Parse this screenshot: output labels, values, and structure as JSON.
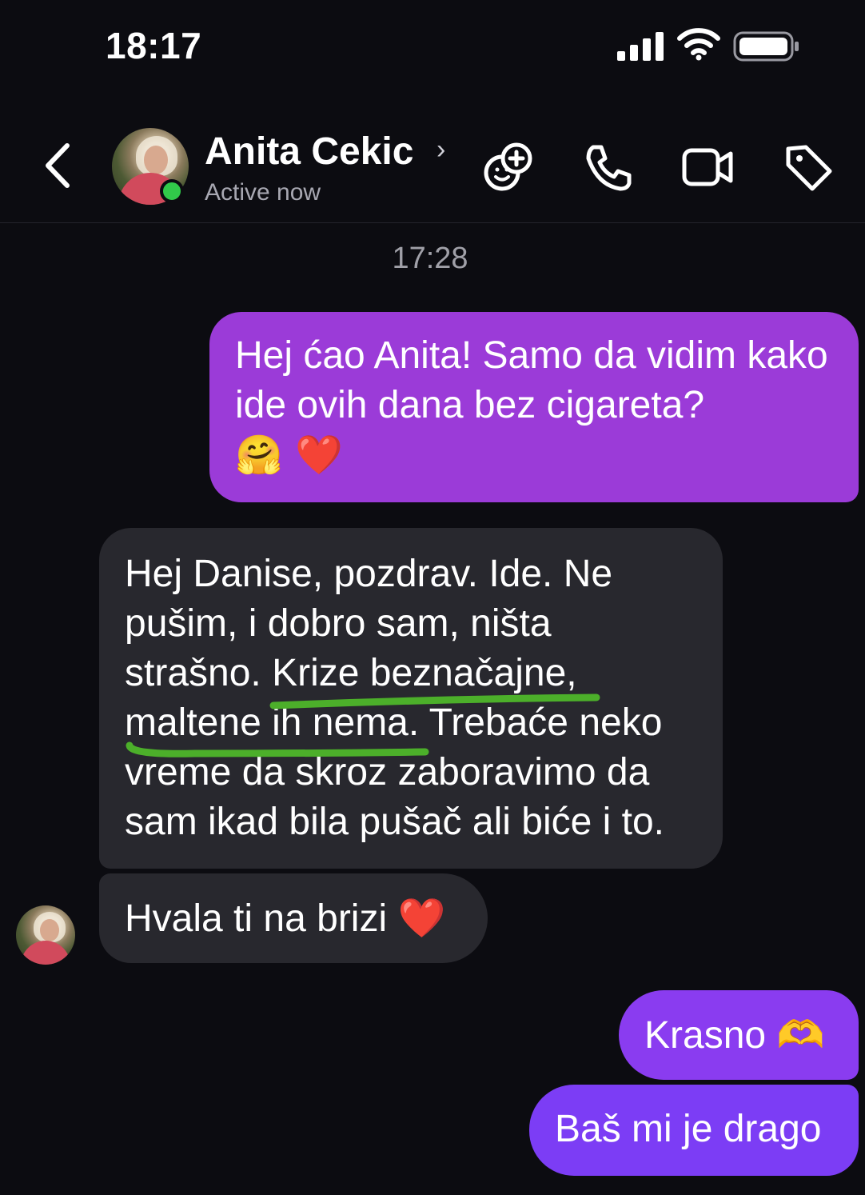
{
  "status_bar": {
    "time": "18:17"
  },
  "header": {
    "contact_name": "Anita Cekic",
    "name_chevron": "›",
    "status": "Active now",
    "icons": [
      "back-chevron-icon",
      "effects-add-icon",
      "phone-icon",
      "video-camera-icon",
      "tag-icon"
    ]
  },
  "chat": {
    "timestamp": "17:28",
    "messages": [
      {
        "direction": "outgoing",
        "text": "Hej ćao Anita! Samo da vidim kako ide ovih dana bez cigareta?",
        "emoji": "🤗 ❤️"
      },
      {
        "direction": "incoming",
        "text": "Hej Danise, pozdrav. Ide. Ne pušim, i dobro sam, ništa strašno. Krize beznačajne, maltene ih nema. Trebaće neko vreme da skroz zaboravimo da sam ikad bila pušač ali biće i to."
      },
      {
        "direction": "incoming",
        "text": "Hvala ti na brizi",
        "emoji": "❤️"
      },
      {
        "direction": "outgoing",
        "text": "Krasno",
        "emoji": "🫶"
      },
      {
        "direction": "outgoing",
        "text": "Baš mi je drago"
      }
    ]
  },
  "colors": {
    "background": "#0c0c11",
    "outgoing_bubble_top": "#9b3bd8",
    "outgoing_bubble_bottom": "#7c3df5",
    "incoming_bubble": "#28282e",
    "online_dot": "#31c94a",
    "highlight_marker": "#4caf2a"
  }
}
